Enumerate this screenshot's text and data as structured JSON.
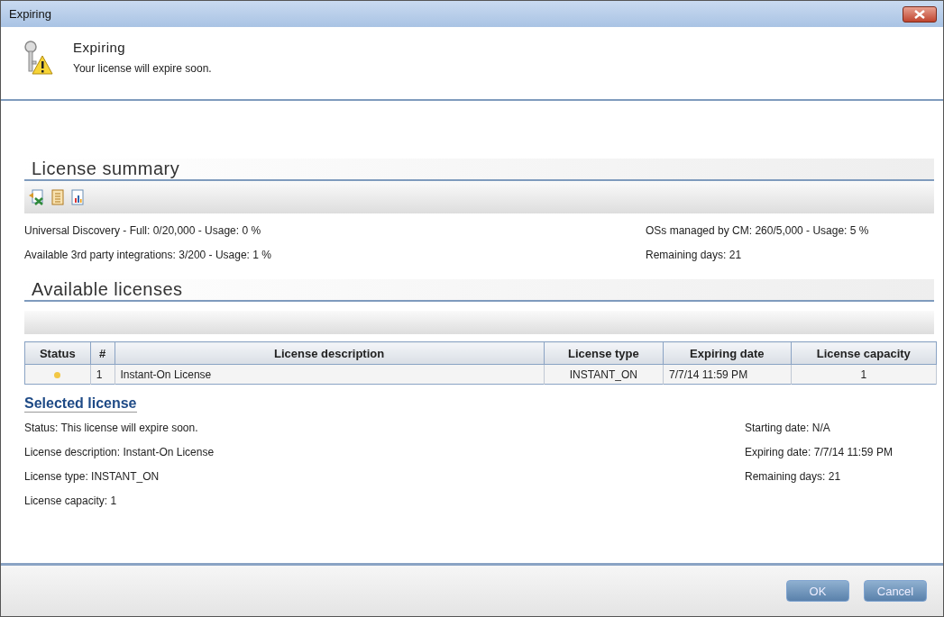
{
  "window": {
    "title": "Expiring"
  },
  "header": {
    "title": "Expiring",
    "message": "Your license will expire soon."
  },
  "summary": {
    "heading": "License summary",
    "left": [
      "Universal Discovery - Full: 0/20,000 - Usage: 0 %",
      "Available 3rd party integrations: 3/200 - Usage: 1 %"
    ],
    "right": [
      "OSs managed by CM: 260/5,000 - Usage: 5 %",
      "Remaining days: 21"
    ]
  },
  "available": {
    "heading": "Available licenses",
    "table": {
      "columns": [
        "Status",
        "#",
        "License description",
        "License type",
        "Expiring date",
        "License capacity"
      ],
      "rows": [
        {
          "color": "#f2c744",
          "number": "1",
          "description": "Instant-On License",
          "type": "INSTANT_ON",
          "expiring": "7/7/14 11:59 PM",
          "capacity": "1"
        }
      ]
    }
  },
  "selected": {
    "heading": "Selected license",
    "left": [
      "Status: This license will expire soon.",
      "License description: Instant-On License",
      "License type: INSTANT_ON",
      "License capacity: 1"
    ],
    "right": [
      "Starting date: N/A",
      "Expiring date: 7/7/14 11:59 PM",
      "Remaining days: 21"
    ]
  },
  "buttons": [
    "OK",
    "Cancel"
  ]
}
